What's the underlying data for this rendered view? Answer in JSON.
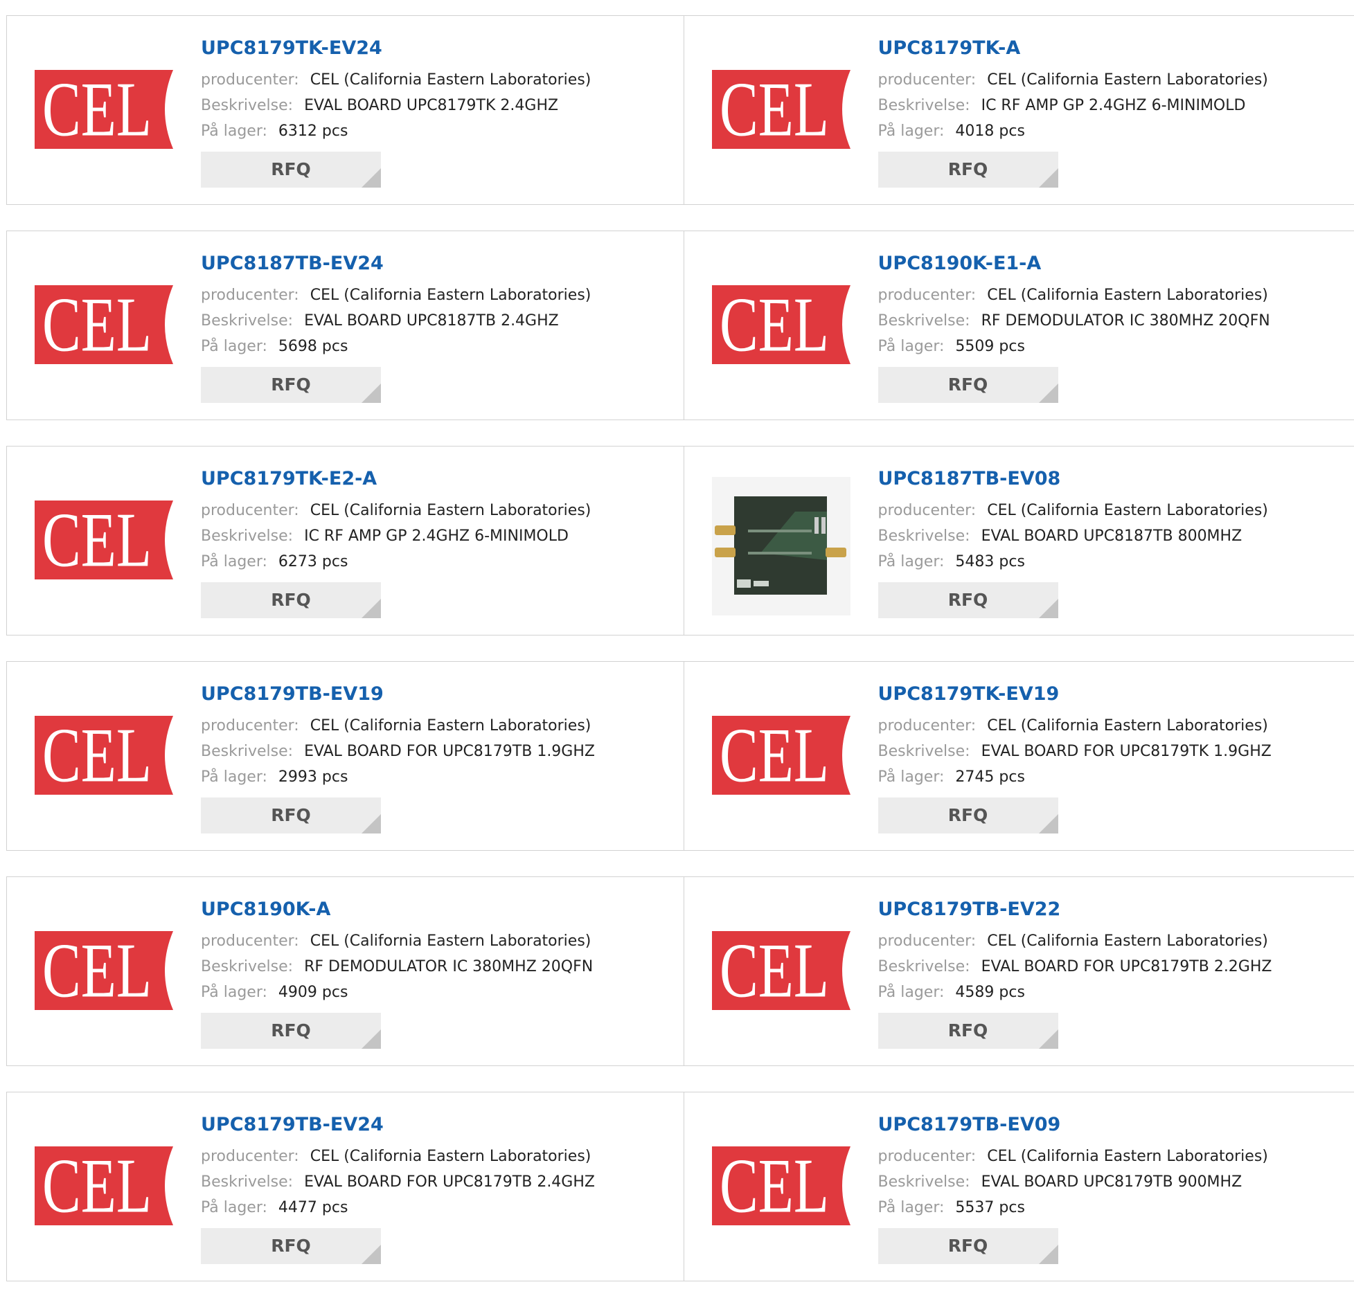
{
  "colors": {
    "brand_red": "#e0393e",
    "link_blue": "#1560ad",
    "label_gray": "#9a9a9a"
  },
  "logo_text": "CEL",
  "labels": {
    "manufacturer": "producenter:",
    "description": "Beskrivelse:",
    "stock": "På lager:"
  },
  "rfq_label": "RFQ",
  "products": [
    {
      "part": "UPC8179TK-EV24",
      "manufacturer": "CEL (California Eastern Laboratories)",
      "description": "EVAL BOARD UPC8179TK 2.4GHZ",
      "stock": "6312 pcs",
      "image": "cel-logo"
    },
    {
      "part": "UPC8179TK-A",
      "manufacturer": "CEL (California Eastern Laboratories)",
      "description": "IC RF AMP GP 2.4GHZ 6-MINIMOLD",
      "stock": "4018 pcs",
      "image": "cel-logo"
    },
    {
      "part": "UPC8187TB-EV24",
      "manufacturer": "CEL (California Eastern Laboratories)",
      "description": "EVAL BOARD UPC8187TB 2.4GHZ",
      "stock": "5698 pcs",
      "image": "cel-logo"
    },
    {
      "part": "UPC8190K-E1-A",
      "manufacturer": "CEL (California Eastern Laboratories)",
      "description": "RF DEMODULATOR IC 380MHZ 20QFN",
      "stock": "5509 pcs",
      "image": "cel-logo"
    },
    {
      "part": "UPC8179TK-E2-A",
      "manufacturer": "CEL (California Eastern Laboratories)",
      "description": "IC RF AMP GP 2.4GHZ 6-MINIMOLD",
      "stock": "6273 pcs",
      "image": "cel-logo"
    },
    {
      "part": "UPC8187TB-EV08",
      "manufacturer": "CEL (California Eastern Laboratories)",
      "description": "EVAL BOARD UPC8187TB 800MHZ",
      "stock": "5483 pcs",
      "image": "board-photo"
    },
    {
      "part": "UPC8179TB-EV19",
      "manufacturer": "CEL (California Eastern Laboratories)",
      "description": "EVAL BOARD FOR UPC8179TB 1.9GHZ",
      "stock": "2993 pcs",
      "image": "cel-logo"
    },
    {
      "part": "UPC8179TK-EV19",
      "manufacturer": "CEL (California Eastern Laboratories)",
      "description": "EVAL BOARD FOR UPC8179TK 1.9GHZ",
      "stock": "2745 pcs",
      "image": "cel-logo"
    },
    {
      "part": "UPC8190K-A",
      "manufacturer": "CEL (California Eastern Laboratories)",
      "description": "RF DEMODULATOR IC 380MHZ 20QFN",
      "stock": "4909 pcs",
      "image": "cel-logo"
    },
    {
      "part": "UPC8179TB-EV22",
      "manufacturer": "CEL (California Eastern Laboratories)",
      "description": "EVAL BOARD FOR UPC8179TB 2.2GHZ",
      "stock": "4589 pcs",
      "image": "cel-logo"
    },
    {
      "part": "UPC8179TB-EV24",
      "manufacturer": "CEL (California Eastern Laboratories)",
      "description": "EVAL BOARD FOR UPC8179TB 2.4GHZ",
      "stock": "4477 pcs",
      "image": "cel-logo"
    },
    {
      "part": "UPC8179TB-EV09",
      "manufacturer": "CEL (California Eastern Laboratories)",
      "description": "EVAL BOARD UPC8179TB 900MHZ",
      "stock": "5537 pcs",
      "image": "cel-logo"
    }
  ]
}
